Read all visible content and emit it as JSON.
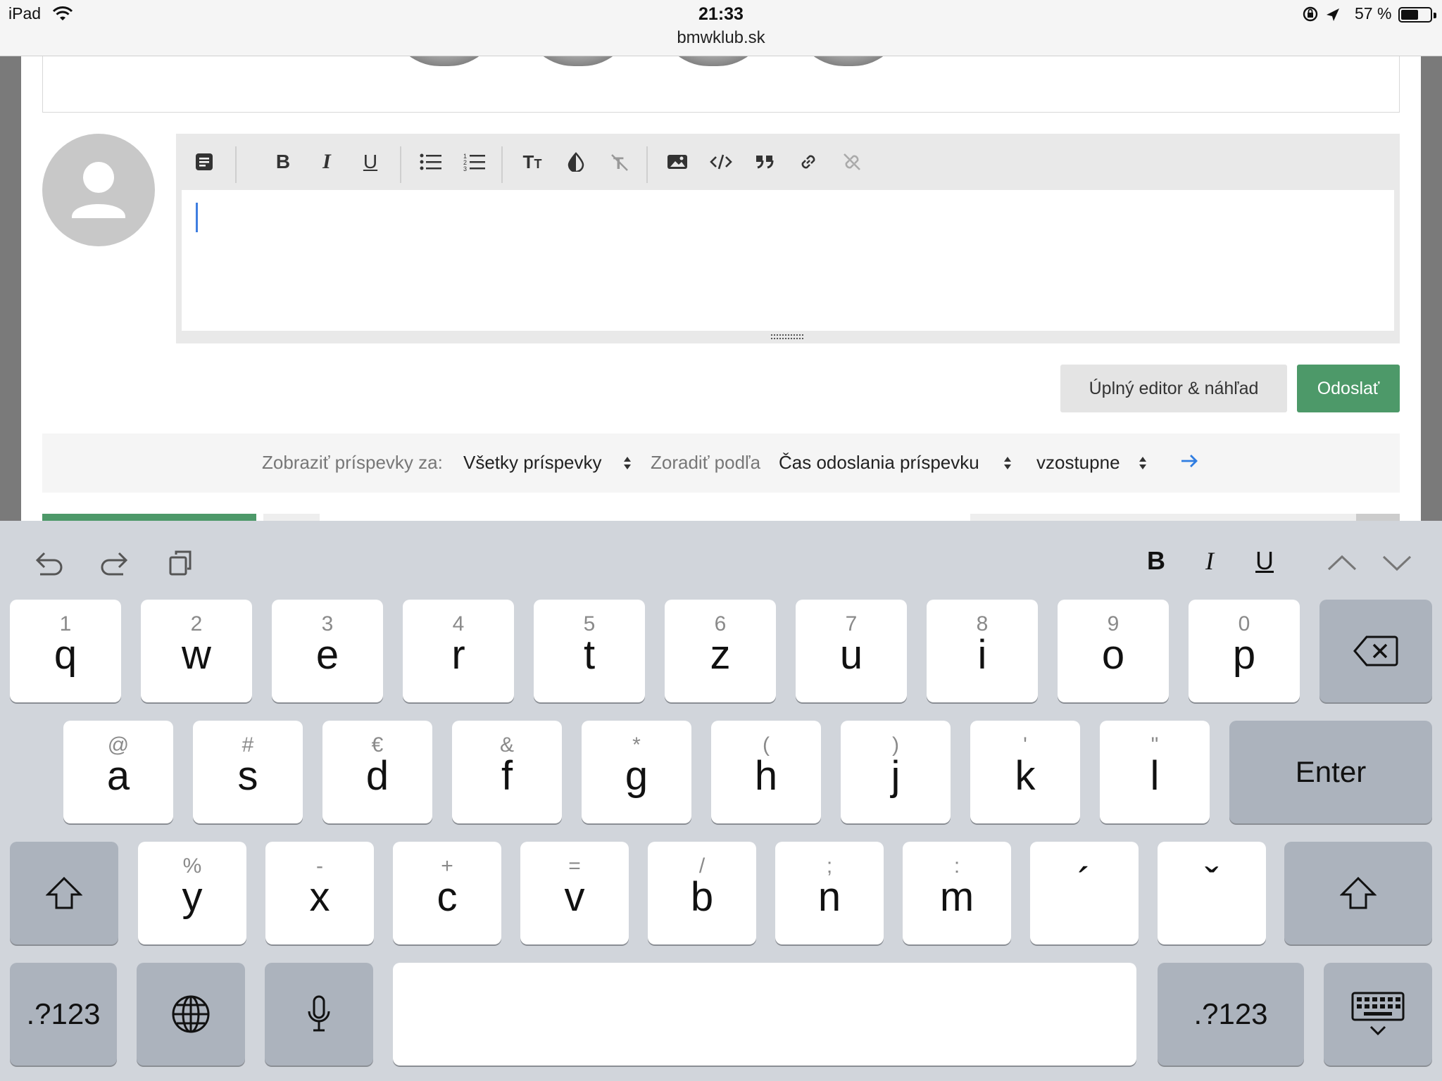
{
  "status_bar": {
    "device": "iPad",
    "time": "21:33",
    "url": "bmwklub.sk",
    "battery": "57 %",
    "battery_level": 0.57
  },
  "editor": {
    "toolbar": [
      {
        "name": "toggle-bb-code-icon"
      },
      {
        "name": "bold-icon"
      },
      {
        "name": "italic-icon"
      },
      {
        "name": "underline-icon"
      },
      {
        "name": "bullet-list-icon"
      },
      {
        "name": "numbered-list-icon"
      },
      {
        "name": "font-size-icon"
      },
      {
        "name": "text-color-icon"
      },
      {
        "name": "remove-format-icon"
      },
      {
        "name": "insert-image-icon"
      },
      {
        "name": "code-icon"
      },
      {
        "name": "quote-icon"
      },
      {
        "name": "link-icon"
      },
      {
        "name": "unlink-icon"
      }
    ]
  },
  "actions": {
    "full_editor": "Úplný editor & náhľad",
    "send": "Odoslať"
  },
  "filter": {
    "show_label": "Zobraziť príspevky za:",
    "show_value": "Všetky príspevky",
    "sort_label": "Zoradiť podľa",
    "sort_value": "Čas odoslania príspevku",
    "order_value": "vzostupne"
  },
  "colors": {
    "send_green": "#4d9969",
    "caret_blue": "#3f7ee0",
    "link_blue": "#2f7de1"
  },
  "keyboard": {
    "row1": [
      {
        "sub": "1",
        "main": "q"
      },
      {
        "sub": "2",
        "main": "w"
      },
      {
        "sub": "3",
        "main": "e"
      },
      {
        "sub": "4",
        "main": "r"
      },
      {
        "sub": "5",
        "main": "t"
      },
      {
        "sub": "6",
        "main": "z"
      },
      {
        "sub": "7",
        "main": "u"
      },
      {
        "sub": "8",
        "main": "i"
      },
      {
        "sub": "9",
        "main": "o"
      },
      {
        "sub": "0",
        "main": "p"
      }
    ],
    "row2": [
      {
        "sub": "@",
        "main": "a"
      },
      {
        "sub": "#",
        "main": "s"
      },
      {
        "sub": "€",
        "main": "d"
      },
      {
        "sub": "&",
        "main": "f"
      },
      {
        "sub": "*",
        "main": "g"
      },
      {
        "sub": "(",
        "main": "h"
      },
      {
        "sub": ")",
        "main": "j"
      },
      {
        "sub": "'",
        "main": "k"
      },
      {
        "sub": "\"",
        "main": "l"
      }
    ],
    "row3": [
      {
        "sub": "%",
        "main": "y"
      },
      {
        "sub": "-",
        "main": "x"
      },
      {
        "sub": "+",
        "main": "c"
      },
      {
        "sub": "=",
        "main": "v"
      },
      {
        "sub": "/",
        "main": "b"
      },
      {
        "sub": ";",
        "main": "n"
      },
      {
        "sub": ":",
        "main": "m"
      },
      {
        "sub": "",
        "main": "´"
      },
      {
        "sub": "",
        "main": "ˇ"
      }
    ],
    "enter": "Enter",
    "numbers_left": ".?123",
    "numbers_right": ".?123",
    "format_bold": "B",
    "format_italic": "I",
    "format_underline": "U"
  }
}
